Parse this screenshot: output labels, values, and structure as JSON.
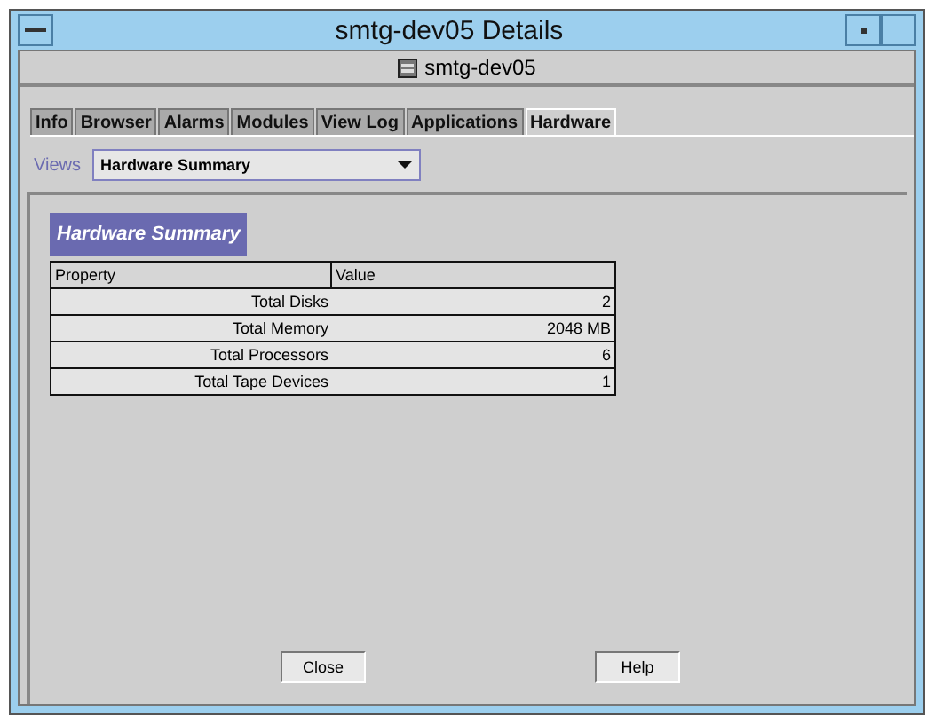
{
  "window": {
    "title": "smtg-dev05 Details"
  },
  "host": {
    "name": "smtg-dev05"
  },
  "tabs": [
    {
      "label": "Info",
      "selected": false
    },
    {
      "label": "Browser",
      "selected": false
    },
    {
      "label": "Alarms",
      "selected": false
    },
    {
      "label": "Modules",
      "selected": false
    },
    {
      "label": "View Log",
      "selected": false
    },
    {
      "label": "Applications",
      "selected": false
    },
    {
      "label": "Hardware",
      "selected": true
    }
  ],
  "views": {
    "label": "Views",
    "value": "Hardware Summary"
  },
  "section_title": "Hardware Summary",
  "table": {
    "columns": [
      "Property",
      "Value"
    ],
    "rows": [
      [
        "Total Disks",
        "2"
      ],
      [
        "Total Memory",
        "2048 MB"
      ],
      [
        "Total Processors",
        "6"
      ],
      [
        "Total Tape Devices",
        "1"
      ]
    ]
  },
  "buttons": [
    "Close",
    "Help"
  ]
}
